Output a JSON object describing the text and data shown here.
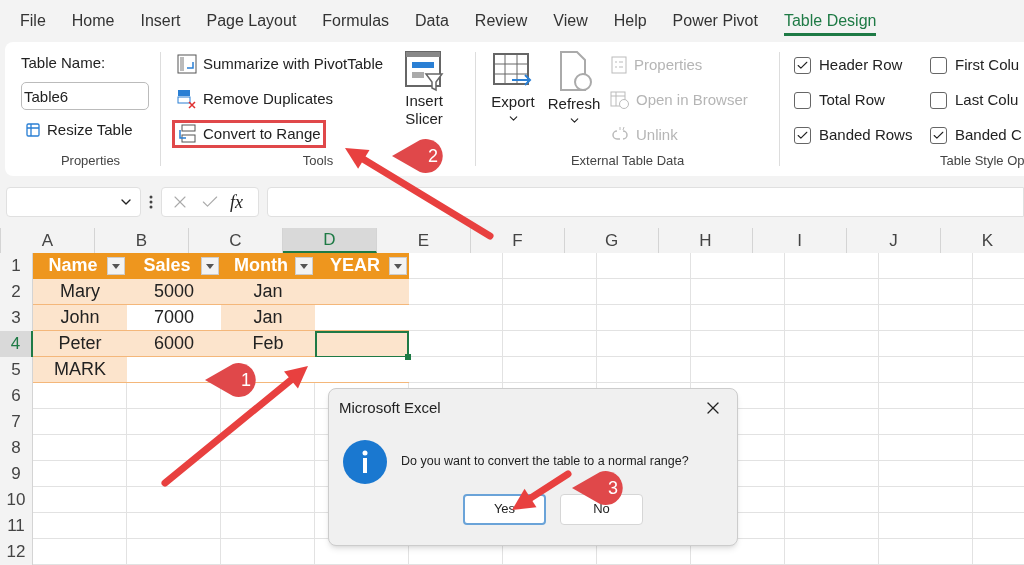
{
  "ribbon_tabs": [
    {
      "label": "File",
      "selected": false
    },
    {
      "label": "Home",
      "selected": false
    },
    {
      "label": "Insert",
      "selected": false
    },
    {
      "label": "Page Layout",
      "selected": false
    },
    {
      "label": "Formulas",
      "selected": false
    },
    {
      "label": "Data",
      "selected": false
    },
    {
      "label": "Review",
      "selected": false
    },
    {
      "label": "View",
      "selected": false
    },
    {
      "label": "Help",
      "selected": false
    },
    {
      "label": "Power Pivot",
      "selected": false
    },
    {
      "label": "Table Design",
      "selected": true
    }
  ],
  "ribbon": {
    "properties_group": {
      "table_name_label": "Table Name:",
      "table_name_value": "Table6",
      "resize_button": "Resize Table",
      "group_label": "Properties"
    },
    "tools_group": {
      "items": [
        {
          "kind": "pivot",
          "label": "Summarize with PivotTable",
          "highlighted": false
        },
        {
          "kind": "duplicates",
          "label": "Remove Duplicates",
          "highlighted": false
        },
        {
          "kind": "convert",
          "label": "Convert to Range",
          "highlighted": true
        }
      ],
      "slicer_lines": [
        "Insert",
        "Slicer"
      ],
      "group_label": "Tools"
    },
    "external_group": {
      "export_button": "Export",
      "refresh_button": "Refresh",
      "items": [
        {
          "kind": "properties",
          "label": "Properties",
          "disabled": true
        },
        {
          "kind": "browser",
          "label": "Open in Browser",
          "disabled": true
        },
        {
          "kind": "unlink",
          "label": "Unlink",
          "disabled": true
        }
      ],
      "group_label": "External Table Data"
    },
    "style_options_group": {
      "options": [
        {
          "label": "Header Row",
          "checked": true
        },
        {
          "label": "Total Row",
          "checked": false
        },
        {
          "label": "Banded Rows",
          "checked": true
        },
        {
          "label": "First Colu",
          "checked": false
        },
        {
          "label": "Last Colu",
          "checked": false
        },
        {
          "label": "Banded C",
          "checked": true
        }
      ],
      "group_label": "Table Style Op"
    }
  },
  "formula_bar": {
    "fx_label": "fx"
  },
  "sheet": {
    "columns": [
      {
        "label": "A",
        "selected": false
      },
      {
        "label": "B",
        "selected": false
      },
      {
        "label": "C",
        "selected": false
      },
      {
        "label": "D",
        "selected": true
      },
      {
        "label": "E",
        "selected": false
      },
      {
        "label": "F",
        "selected": false
      },
      {
        "label": "G",
        "selected": false
      },
      {
        "label": "H",
        "selected": false
      },
      {
        "label": "I",
        "selected": false
      },
      {
        "label": "J",
        "selected": false
      },
      {
        "label": "K",
        "selected": false
      }
    ],
    "rows": [
      {
        "number": "1",
        "selected": false,
        "cells": [
          {
            "text": "Name",
            "kind": "header"
          },
          {
            "text": "Sales",
            "kind": "header"
          },
          {
            "text": "Month",
            "kind": "header"
          },
          {
            "text": "YEAR",
            "kind": "header"
          }
        ]
      },
      {
        "number": "2",
        "selected": false,
        "cells": [
          {
            "text": "Mary",
            "kind": "shaded"
          },
          {
            "text": "5000",
            "kind": "shaded"
          },
          {
            "text": "Jan",
            "kind": "shaded"
          },
          {
            "text": "",
            "kind": "shaded"
          }
        ]
      },
      {
        "number": "3",
        "selected": false,
        "cells": [
          {
            "text": "John",
            "kind": "shaded"
          },
          {
            "text": "7000",
            "kind": "plain"
          },
          {
            "text": "Jan",
            "kind": "shaded"
          },
          {
            "text": "",
            "kind": "plain"
          }
        ]
      },
      {
        "number": "4",
        "selected": true,
        "cells": [
          {
            "text": "Peter",
            "kind": "shaded"
          },
          {
            "text": "6000",
            "kind": "shaded"
          },
          {
            "text": "Feb",
            "kind": "shaded"
          },
          {
            "text": "",
            "kind": "active"
          }
        ]
      },
      {
        "number": "5",
        "selected": false,
        "cells": [
          {
            "text": "MARK",
            "kind": "shaded"
          },
          {
            "text": "",
            "kind": "plain"
          },
          {
            "text": "",
            "kind": "plain"
          },
          {
            "text": "",
            "kind": "plain"
          }
        ]
      },
      {
        "number": "6",
        "selected": false,
        "cells": []
      },
      {
        "number": "7",
        "selected": false,
        "cells": []
      },
      {
        "number": "8",
        "selected": false,
        "cells": []
      },
      {
        "number": "9",
        "selected": false,
        "cells": []
      },
      {
        "number": "10",
        "selected": false,
        "cells": []
      },
      {
        "number": "11",
        "selected": false,
        "cells": []
      },
      {
        "number": "12",
        "selected": false,
        "cells": []
      }
    ]
  },
  "dialog": {
    "title": "Microsoft Excel",
    "message": "Do you want to convert the table to a normal range?",
    "buttons": [
      {
        "label": "Yes",
        "selected": true
      },
      {
        "label": "No",
        "selected": false
      }
    ]
  },
  "callouts": [
    {
      "label": "1"
    },
    {
      "label": "2"
    },
    {
      "label": "3"
    }
  ]
}
